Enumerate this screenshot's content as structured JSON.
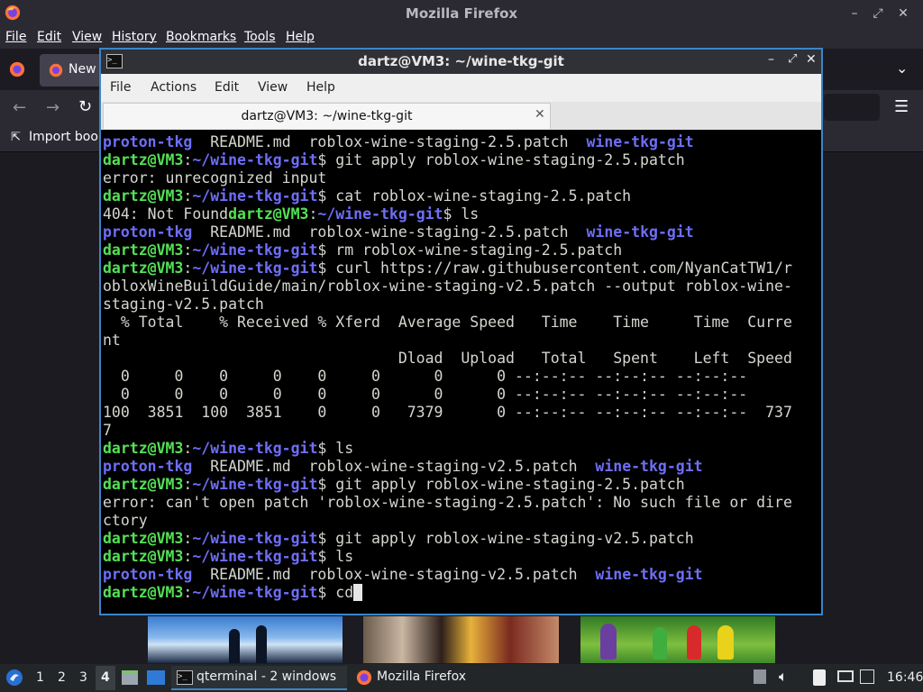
{
  "firefox": {
    "title": "Mozilla Firefox",
    "menu": [
      "File",
      "Edit",
      "View",
      "History",
      "Bookmarks",
      "Tools",
      "Help"
    ],
    "tab_label": "New",
    "bookmark_label": "Import book"
  },
  "terminal": {
    "title": "dartz@VM3: ~/wine-tkg-git",
    "menu": [
      "File",
      "Actions",
      "Edit",
      "View",
      "Help"
    ],
    "tab_label": "dartz@VM3: ~/wine-tkg-git",
    "user": "dartz@VM3",
    "path": "~/wine-tkg-git",
    "lines": [
      {
        "type": "ls",
        "items": [
          "proton-tkg",
          "README.md",
          "roblox-wine-staging-2.5.patch",
          "wine-tkg-git"
        ]
      },
      {
        "type": "cmd",
        "cmd": "git apply roblox-wine-staging-2.5.patch"
      },
      {
        "type": "out",
        "text": "error: unrecognized input"
      },
      {
        "type": "cmd",
        "cmd": "cat roblox-wine-staging-2.5.patch"
      },
      {
        "type": "cmdpre",
        "pre": "404: Not Found",
        "cmd": "ls"
      },
      {
        "type": "ls",
        "items": [
          "proton-tkg",
          "README.md",
          "roblox-wine-staging-2.5.patch",
          "wine-tkg-git"
        ]
      },
      {
        "type": "cmd",
        "cmd": "rm roblox-wine-staging-2.5.patch"
      },
      {
        "type": "cmd",
        "cmd": "curl https://raw.githubusercontent.com/NyanCatTW1/r"
      },
      {
        "type": "out",
        "text": "obloxWineBuildGuide/main/roblox-wine-staging-v2.5.patch --output roblox-wine-"
      },
      {
        "type": "out",
        "text": "staging-v2.5.patch"
      },
      {
        "type": "out",
        "text": "  % Total    % Received % Xferd  Average Speed   Time    Time     Time  Curre"
      },
      {
        "type": "out",
        "text": "nt"
      },
      {
        "type": "out",
        "text": "                                 Dload  Upload   Total   Spent    Left  Speed"
      },
      {
        "type": "out",
        "text": "  0     0    0     0    0     0      0      0 --:--:-- --:--:-- --:--:--"
      },
      {
        "type": "out",
        "text": "  0     0    0     0    0     0      0      0 --:--:-- --:--:-- --:--:--"
      },
      {
        "type": "out",
        "text": "100  3851  100  3851    0     0   7379      0 --:--:-- --:--:-- --:--:--  737"
      },
      {
        "type": "out",
        "text": "7"
      },
      {
        "type": "cmd",
        "cmd": "ls"
      },
      {
        "type": "ls",
        "items": [
          "proton-tkg",
          "README.md",
          "roblox-wine-staging-v2.5.patch",
          "wine-tkg-git"
        ]
      },
      {
        "type": "cmd",
        "cmd": "git apply roblox-wine-staging-2.5.patch"
      },
      {
        "type": "out",
        "text": "error: can't open patch 'roblox-wine-staging-2.5.patch': No such file or dire"
      },
      {
        "type": "out",
        "text": "ctory"
      },
      {
        "type": "cmd",
        "cmd": "git apply roblox-wine-staging-v2.5.patch"
      },
      {
        "type": "cmd",
        "cmd": "ls"
      },
      {
        "type": "ls",
        "items": [
          "proton-tkg",
          "README.md",
          "roblox-wine-staging-v2.5.patch",
          "wine-tkg-git"
        ]
      },
      {
        "type": "cmd",
        "cmd": "cd",
        "cursor": true
      }
    ]
  },
  "taskbar": {
    "workspaces": [
      "1",
      "2",
      "3",
      "4"
    ],
    "active_workspace": "4",
    "tasks": [
      {
        "label": "qterminal - 2 windows",
        "icon": "terminal-icon"
      },
      {
        "label": "Mozilla Firefox",
        "icon": "firefox-icon"
      }
    ],
    "clock": "16:46"
  },
  "colors": {
    "user": "#55e055",
    "path": "#6e6ef7",
    "accent": "#3a86c8"
  }
}
